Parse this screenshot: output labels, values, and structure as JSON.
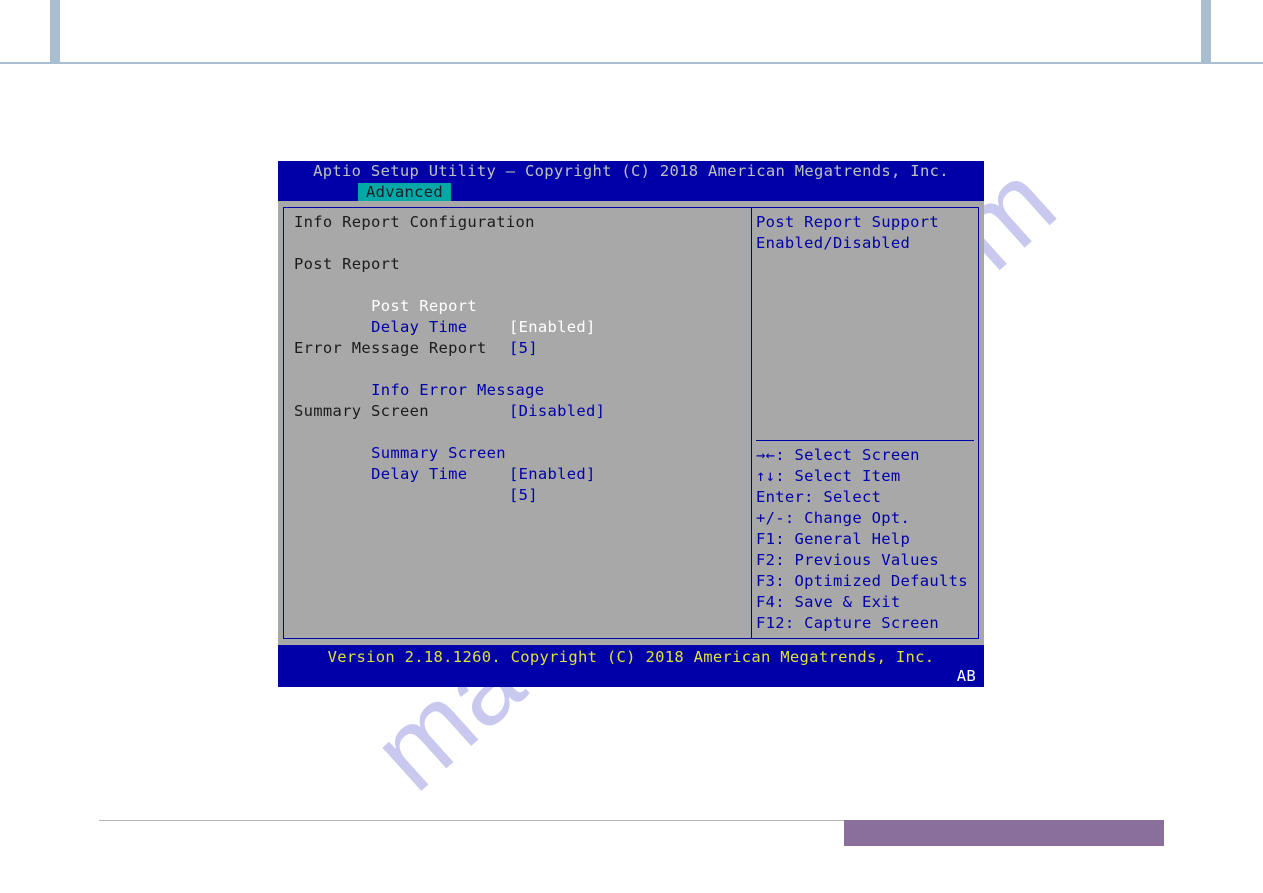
{
  "bios": {
    "title": "Aptio Setup Utility – Copyright (C) 2018 American Megatrends, Inc.",
    "tab": "Advanced",
    "sections": {
      "heading": "Info Report Configuration",
      "post_report_header": "Post Report",
      "post_report_label": "Post Report",
      "post_report_value": "[Enabled]",
      "delay_time1_label": "Delay Time",
      "delay_time1_value": "[5]",
      "error_header": "Error Message Report",
      "info_error_label": "Info Error Message",
      "info_error_value": "[Disabled]",
      "summary_header": "Summary Screen",
      "summary_label": "Summary Screen",
      "summary_value": "[Enabled]",
      "delay_time2_label": "Delay Time",
      "delay_time2_value": "[5]"
    },
    "help": {
      "line1": "Post Report Support",
      "line2": "Enabled/Disabled"
    },
    "keys": {
      "k1": "→←: Select Screen",
      "k2": "↑↓: Select Item",
      "k3": "Enter: Select",
      "k4": "+/-: Change Opt.",
      "k5": "F1: General Help",
      "k6": "F2: Previous Values",
      "k7": "F3: Optimized Defaults",
      "k8": "F4: Save & Exit",
      "k9": "F12: Capture Screen"
    },
    "footer": "Version 2.18.1260. Copyright (C) 2018 American Megatrends, Inc.",
    "footer_tag": "AB"
  },
  "watermark": "manualshive.com"
}
